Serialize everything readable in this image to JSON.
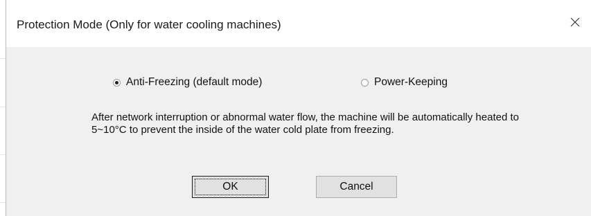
{
  "dialog": {
    "title": "Protection Mode (Only for water cooling machines)",
    "close_icon": "close-icon"
  },
  "mode_options": [
    {
      "label": "Anti-Freezing (default mode)",
      "checked": true
    },
    {
      "label": "Power-Keeping",
      "checked": false
    }
  ],
  "description": "After network interruption or abnormal water flow, the machine will be automatically heated to 5~10°C to prevent the inside of the water cold plate from freezing.",
  "buttons": {
    "ok_label": "OK",
    "cancel_label": "Cancel"
  },
  "colors": {
    "dialog_background": "#f0f0f0",
    "titlebar_background": "#ffffff",
    "button_background": "#e1e1e1",
    "button_border": "#adadad"
  }
}
